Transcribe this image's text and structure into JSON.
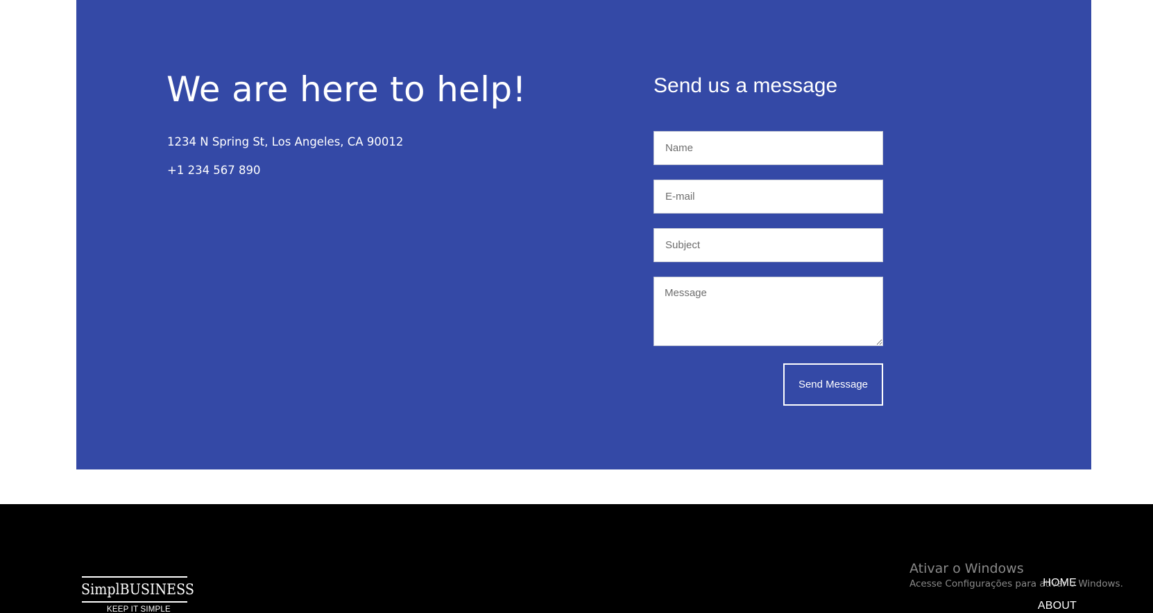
{
  "contact": {
    "heading": "We are here to help!",
    "address": "1234 N Spring St, Los Angeles, CA 90012",
    "phone": "+1 234 567 890",
    "background_color": "#3449a6"
  },
  "form": {
    "heading": "Send us a message",
    "name_placeholder": "Name",
    "email_placeholder": "E-mail",
    "subject_placeholder": "Subject",
    "message_placeholder": "Message",
    "submit_label": "Send Message"
  },
  "footer": {
    "logo": {
      "name": "SimplBUSINESS",
      "tagline": "KEEP IT SIMPLE"
    },
    "nav": [
      {
        "label": "HOME"
      },
      {
        "label": "ABOUT"
      }
    ],
    "background_color": "#000000"
  },
  "watermark": {
    "title": "Ativar o Windows",
    "text": "Acesse Configurações para ativar o Windows."
  }
}
